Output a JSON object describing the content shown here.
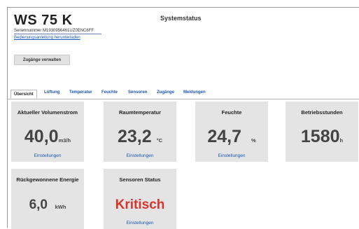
{
  "header": {
    "model": "WS 75 K",
    "serial": "Seriennummer M1930956461UZ0ENC6FF",
    "manual_link": "Bedienungsanleitung herunterladen",
    "system_title": "Systemstatus",
    "access_button": "Zugänge verwalten"
  },
  "tabs": [
    {
      "label": "Übersicht"
    },
    {
      "label": "Lüftung"
    },
    {
      "label": "Temperatur"
    },
    {
      "label": "Feuchte"
    },
    {
      "label": "Sensoren"
    },
    {
      "label": "Zugänge"
    },
    {
      "label": "Meldungen"
    }
  ],
  "cards": {
    "volumenstrom": {
      "label": "Aktueller Volumenstrom",
      "value": "40,0",
      "unit": "m3/h",
      "link": "Einstellungen"
    },
    "raumtemperatur": {
      "label": "Raumtemperatur",
      "value": "23,2",
      "unit": "°C",
      "link": "Einstellungen"
    },
    "feuchte": {
      "label": "Feuchte",
      "value": "24,7",
      "unit": "%",
      "link": "Einstellungen"
    },
    "betriebsstunden": {
      "label": "Betriebsstunden",
      "value": "1580",
      "unit": "h"
    },
    "energie": {
      "label": "Rückgewonnene Energie",
      "value": "6,0",
      "unit": "kWh"
    },
    "sensoren": {
      "label": "Sensoren Status",
      "value": "Kritisch",
      "link": "Einstellungen"
    }
  },
  "colors": {
    "link": "#1a55b8",
    "critical": "#d9342c",
    "card_bg": "#e4e4e4"
  }
}
